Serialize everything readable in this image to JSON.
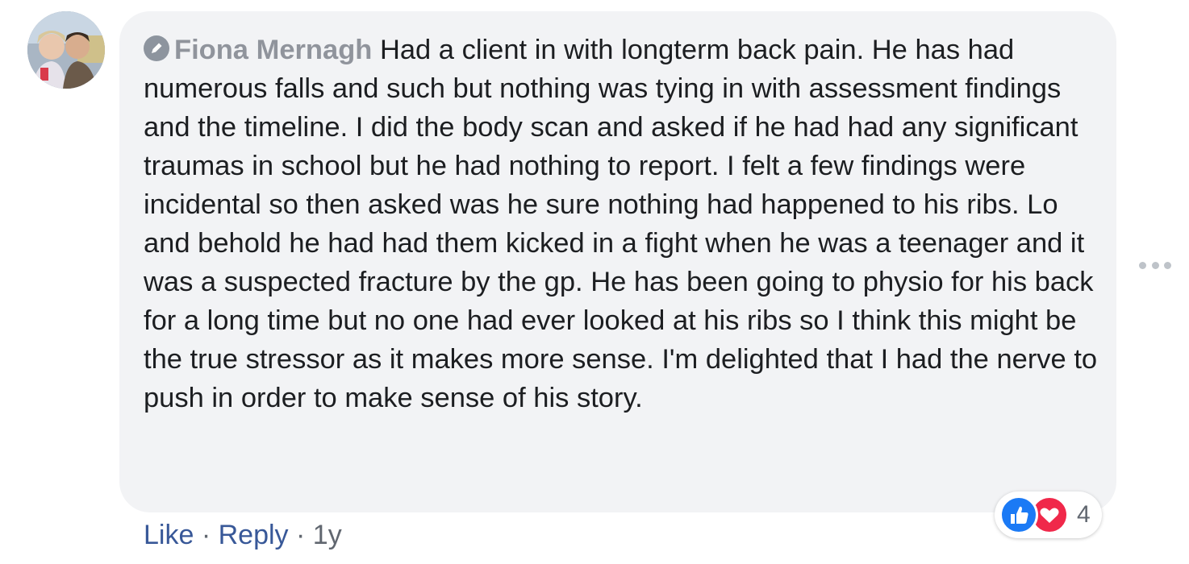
{
  "comment": {
    "author": "Fiona Mernagh",
    "text": "Had a client in with longterm back pain. He has had numerous falls and such but nothing was tying in with assessment findings and the timeline. I did the body scan and asked if he had had any significant traumas in school but he had nothing to report. I felt a few findings were incidental so then asked was he sure nothing had happened to his ribs. Lo and behold he had had them kicked in a fight when he was a teenager and it was a suspected fracture by the gp. He has been going to physio for his back for a long time but no one had ever looked at his ribs so I think this might be the true stressor as it makes more sense. I'm delighted that I had the nerve to push in order to make sense of his story.",
    "like_label": "Like",
    "separator": "·",
    "reply_label": "Reply",
    "timestamp": "1y",
    "reaction_count": "4",
    "reactions": [
      "like-icon",
      "love-icon"
    ]
  },
  "colors": {
    "bubble": "#f2f3f5",
    "author": "#90949c",
    "link": "#385898",
    "like_reaction": "#1b7af5",
    "love_reaction": "#f0284a"
  }
}
